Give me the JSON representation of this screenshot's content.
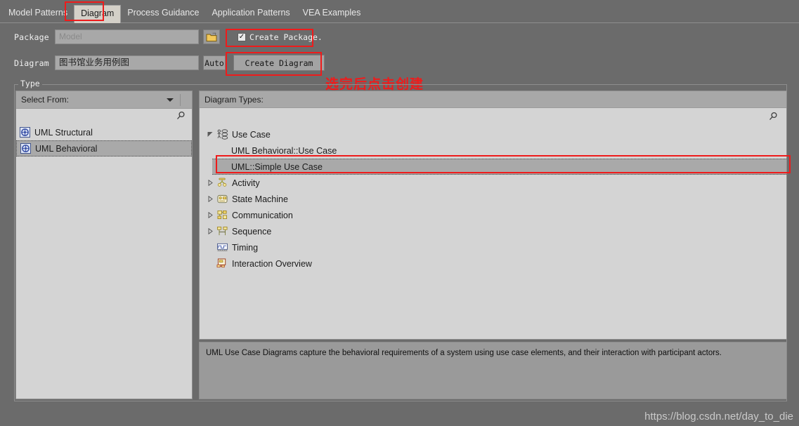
{
  "tabs": [
    {
      "label": "Model Patterns",
      "active": false
    },
    {
      "label": "Diagram",
      "active": true
    },
    {
      "label": "Process Guidance",
      "active": false
    },
    {
      "label": "Application Patterns",
      "active": false
    },
    {
      "label": "VEA Examples",
      "active": false
    }
  ],
  "form": {
    "package_label": "Package",
    "package_value": "",
    "package_placeholder": "Model",
    "browse_icon": "folder-icon",
    "create_package_label": "Create Package.",
    "create_package_checked": true,
    "diagram_label": "Diagram",
    "diagram_value": "图书馆业务用例图",
    "auto_label": "Auto",
    "create_diagram_label": "Create Diagram"
  },
  "annotation": {
    "text": "选完后点击创建",
    "color": "#ee1c1c"
  },
  "group": {
    "title": "Type"
  },
  "left_panel": {
    "select_from_label": "Select From:",
    "search_icon": "search-icon",
    "items": [
      {
        "label": "UML Structural",
        "icon": "uml-icon",
        "selected": false
      },
      {
        "label": "UML Behavioral",
        "icon": "uml-icon",
        "selected": true
      }
    ]
  },
  "right_panel": {
    "header": "Diagram Types:",
    "search_icon": "search-icon",
    "tree": [
      {
        "label": "Use Case",
        "level": 0,
        "twisty": "expanded",
        "icon": "use-case-icon",
        "selected": false
      },
      {
        "label": "UML Behavioral::Use Case",
        "level": 1,
        "twisty": "none",
        "icon": "none",
        "selected": false
      },
      {
        "label": "UML::Simple Use Case",
        "level": 1,
        "twisty": "none",
        "icon": "none",
        "selected": true
      },
      {
        "label": "Activity",
        "level": 0,
        "twisty": "collapsed",
        "icon": "activity-icon",
        "selected": false
      },
      {
        "label": "State Machine",
        "level": 0,
        "twisty": "collapsed",
        "icon": "state-machine-icon",
        "selected": false
      },
      {
        "label": "Communication",
        "level": 0,
        "twisty": "collapsed",
        "icon": "communication-icon",
        "selected": false
      },
      {
        "label": "Sequence",
        "level": 0,
        "twisty": "collapsed",
        "icon": "sequence-icon",
        "selected": false
      },
      {
        "label": "Timing",
        "level": 0,
        "twisty": "none",
        "icon": "timing-icon",
        "selected": false
      },
      {
        "label": "Interaction Overview",
        "level": 0,
        "twisty": "none",
        "icon": "interaction-overview-icon",
        "selected": false
      }
    ]
  },
  "description": {
    "text": "UML Use Case Diagrams capture the behavioral requirements of a system using use case elements, and their interaction with participant actors."
  },
  "watermark": {
    "text": "https://blog.csdn.net/day_to_die"
  }
}
